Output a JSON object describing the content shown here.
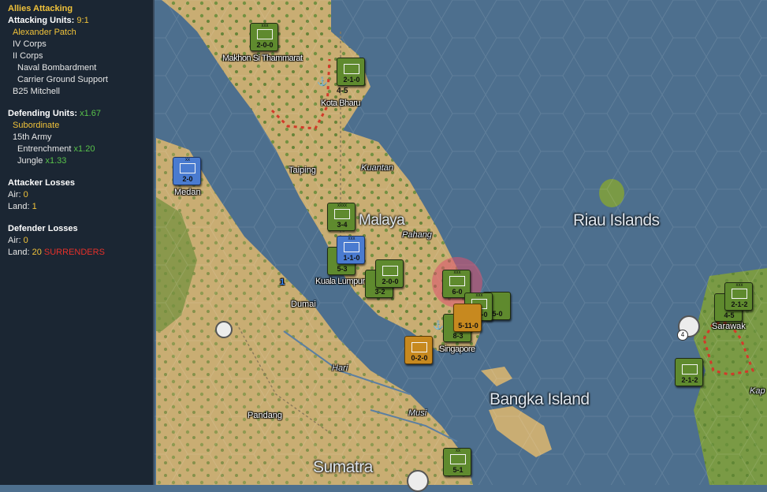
{
  "panel": {
    "title": "Allies Attacking",
    "attacking_units_label": "Attacking Units:",
    "attacking_ratio": "9:1",
    "commander": "Alexander Patch",
    "attacking_list": [
      "IV Corps",
      "II Corps"
    ],
    "attacking_support": [
      "Naval Bombardment",
      "Carrier Ground Support"
    ],
    "attacking_extra": "B25 Mitchell",
    "defending_units_label": "Defending Units:",
    "defending_ratio": "x1.67",
    "defending_commander": "Subordinate",
    "defending_unit": "15th Army",
    "entrenchment_label": "Entrenchment",
    "entrenchment_value": "x1.20",
    "jungle_label": "Jungle",
    "jungle_value": "x1.33",
    "attacker_losses_label": "Attacker Losses",
    "att_air_label": "Air:",
    "att_air_value": "0",
    "att_land_label": "Land:",
    "att_land_value": "1",
    "defender_losses_label": "Defender Losses",
    "def_air_label": "Air:",
    "def_air_value": "0",
    "def_land_label": "Land:",
    "def_land_value": "20",
    "surrenders": "SURRENDERS"
  },
  "places": {
    "makhon": "Makhon Si Thammarat",
    "kota_bharu": "Kota Bharu",
    "taiping": "Taiping",
    "kuantan": "Kuantan",
    "medan": "Medan",
    "malaya": "Malaya",
    "pahang": "Pahang",
    "kuala_lumpur": "Kuala Lumpur",
    "dumai": "Dumai",
    "singapore": "Singapore",
    "riau": "Riau Islands",
    "sarawak": "Sarawak",
    "hari": "Hari",
    "bangka": "Bangka Island",
    "pandang": "Pandang",
    "musi": "Musi",
    "sumatra": "Sumatra",
    "kap": "Kap"
  },
  "units": {
    "u1": "2-0-0",
    "u2": "2-1-0",
    "u2b": "4-5",
    "u3": "2-0",
    "u4": "3-4",
    "u5": "1-1-0",
    "u5b": "5-3",
    "u6": "2-0-0",
    "u6b": "3-2",
    "u7": "6-0",
    "u8": "1-0-0",
    "u8b": "5-0",
    "u9": "5-11-0",
    "u9b": "8-3",
    "u10": "0-2-0",
    "u11": "2-1-2",
    "u11b": "4-5",
    "u12": "2-1-2",
    "u13": "5-1",
    "badge4": "4",
    "badge1": "1"
  },
  "colors": {
    "sea": "#4d6f8e",
    "land": "#c9ad73",
    "jungle": "#6f8f3c",
    "allied_unit": "#5f8a2e",
    "axis_unit": "#c7891f",
    "selected_unit": "#4a7bd0",
    "panel_bg": "#1b2633",
    "highlight_yellow": "#f0c23a",
    "modifier_green": "#58c24a",
    "surrender_red": "#e5302a"
  }
}
